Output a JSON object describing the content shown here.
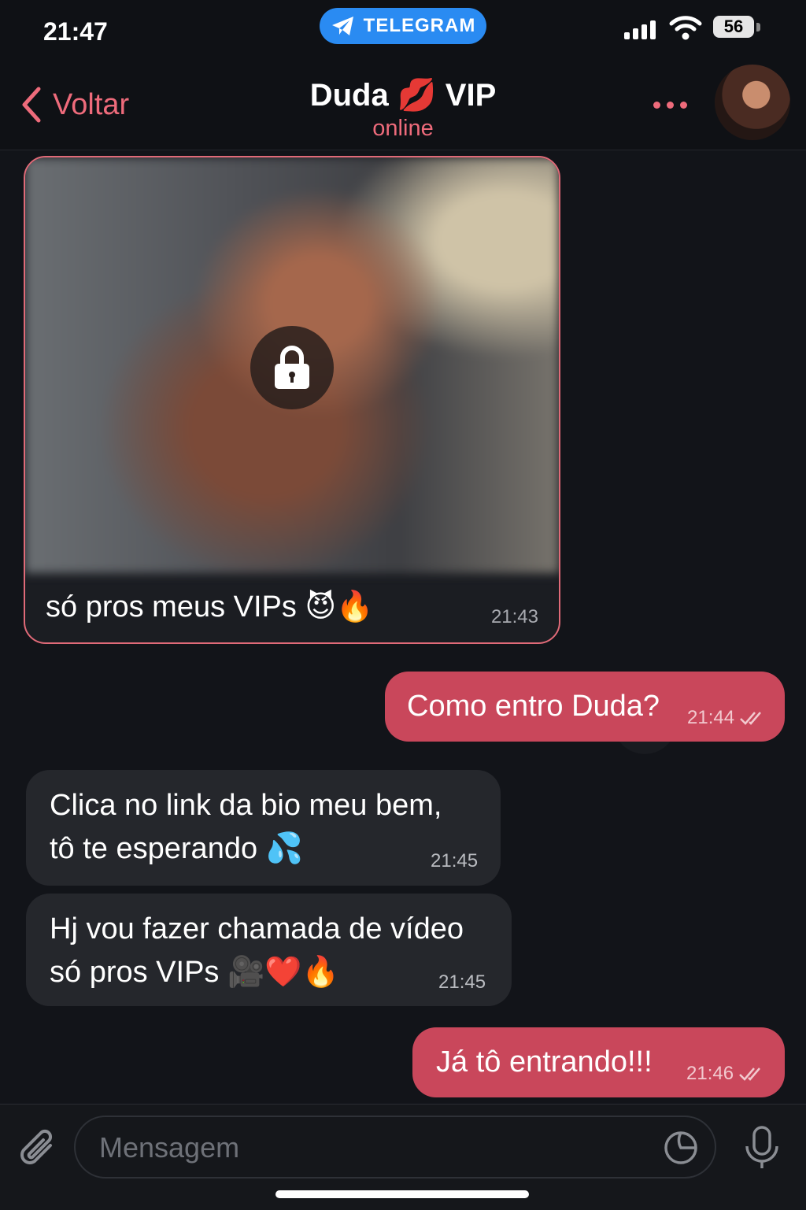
{
  "status_bar": {
    "time": "21:47",
    "app_label": "TELEGRAM",
    "battery": "56"
  },
  "header": {
    "back_label": "Voltar",
    "title_name": "Duda",
    "title_emoji": "💋",
    "title_suffix": "VIP",
    "status": "online"
  },
  "messages": [
    {
      "direction": "in",
      "type": "locked-media",
      "text": "só pros meus VIPs 😈🔥",
      "time": "21:43"
    },
    {
      "direction": "out",
      "text": "Como entro Duda?",
      "time": "21:44",
      "read": true
    },
    {
      "direction": "in",
      "text_lines": [
        "Clica no link da bio meu bem,",
        "tô te esperando 💦"
      ],
      "time": "21:45"
    },
    {
      "direction": "in",
      "text_lines": [
        "Hj vou fazer chamada de vídeo",
        "só pros VIPs 🎥❤️🔥"
      ],
      "time": "21:45"
    },
    {
      "direction": "out",
      "text": "Já tô entrando!!!",
      "time": "21:46",
      "read": true
    }
  ],
  "input": {
    "placeholder": "Mensagem"
  },
  "colors": {
    "accent": "#ee6b7b",
    "outgoing_bubble": "#c9475b",
    "incoming_bubble": "#25272c",
    "telegram_blue": "#2a8bf2"
  }
}
